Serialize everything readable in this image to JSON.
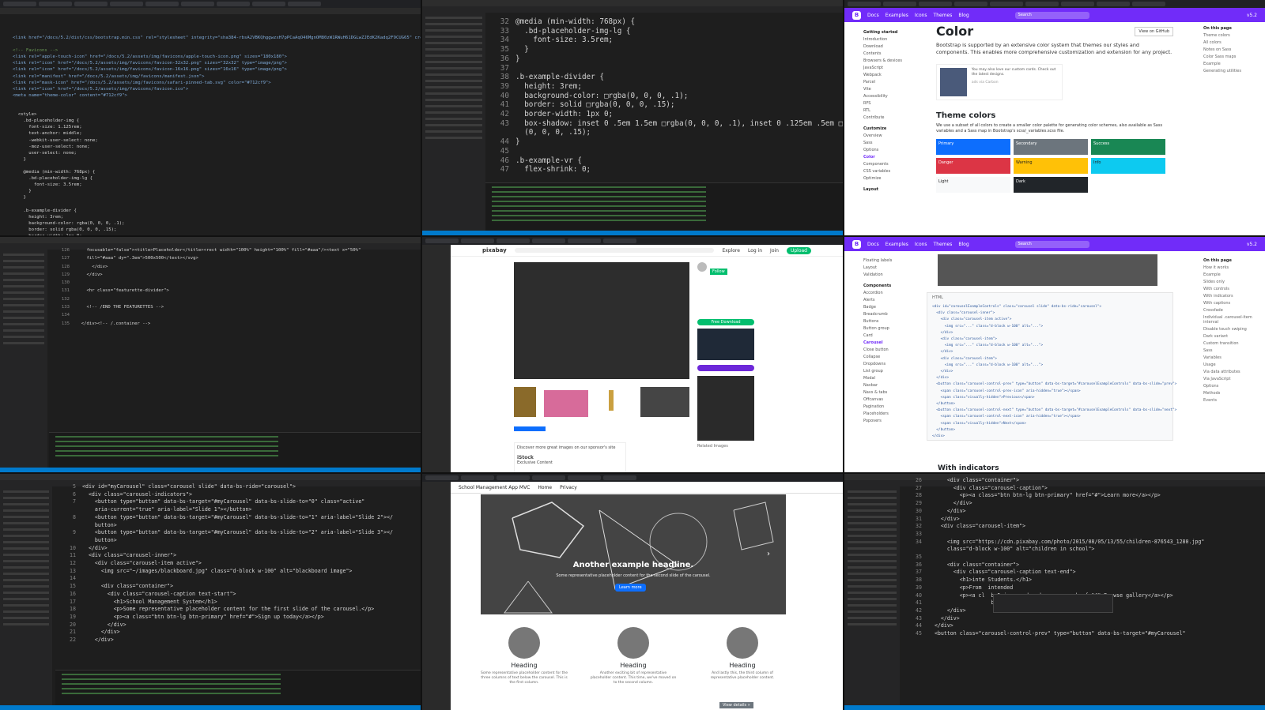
{
  "tile1": {
    "lines": [
      "<link href=\"/docs/5.2/dist/css/bootstrap.min.css\" rel=\"stylesheet\" integrity=\"sha384-rbsA2VBKQhggwzxH7pPCaAqO46MgnOM80zW1RWuH61DGLwZJEdK2Kadq2F9CUG65\" crossorigin=\"anonymous\">",
      "",
      "<!-- Favicons -->",
      "<link rel=\"apple-touch-icon\" href=\"/docs/5.2/assets/img/favicons/apple-touch-icon.png\" sizes=\"180x180\">",
      "<link rel=\"icon\" href=\"/docs/5.2/assets/img/favicons/favicon-32x32.png\" sizes=\"32x32\" type=\"image/png\">",
      "<link rel=\"icon\" href=\"/docs/5.2/assets/img/favicons/favicon-16x16.png\" sizes=\"16x16\" type=\"image/png\">",
      "<link rel=\"manifest\" href=\"/docs/5.2/assets/img/favicons/manifest.json\">",
      "<link rel=\"mask-icon\" href=\"/docs/5.2/assets/img/favicons/safari-pinned-tab.svg\" color=\"#712cf9\">",
      "<link rel=\"icon\" href=\"/docs/5.2/assets/img/favicons/favicon.ico\">",
      "<meta name=\"theme-color\" content=\"#712cf9\">",
      "",
      "",
      "  <style>",
      "    .bd-placeholder-img {",
      "      font-size: 1.125rem;",
      "      text-anchor: middle;",
      "      -webkit-user-select: none;",
      "      -moz-user-select: none;",
      "      user-select: none;",
      "    }",
      "",
      "    @media (min-width: 768px) {",
      "      .bd-placeholder-img-lg {",
      "        font-size: 3.5rem;",
      "      }",
      "    }",
      "",
      "    .b-example-divider {",
      "      height: 3rem;",
      "      background-color: rgba(0, 0, 0, .1);",
      "      border: solid rgba(0, 0, 0, .15);",
      "      border-width: 1px 0;",
      "      box-shadow: inset 0 .5em 1.5em rgba(0, 0, 0, .1), inset 0 .125em .5em rgba(0, 0, 0, .15);"
    ]
  },
  "tile2": {
    "lines": [
      {
        "n": "32",
        "t": "@media (min-width: 768px) {"
      },
      {
        "n": "33",
        "t": "  .bd-placeholder-img-lg {"
      },
      {
        "n": "34",
        "t": "    font-size: 3.5rem;"
      },
      {
        "n": "35",
        "t": "  }"
      },
      {
        "n": "36",
        "t": "}"
      },
      {
        "n": "37",
        "t": ""
      },
      {
        "n": "38",
        "t": ".b-example-divider {"
      },
      {
        "n": "39",
        "t": "  height: 3rem;"
      },
      {
        "n": "40",
        "t": "  background-color: □rgba(0, 0, 0, .1);"
      },
      {
        "n": "41",
        "t": "  border: solid □rgba(0, 0, 0, .15);"
      },
      {
        "n": "42",
        "t": "  border-width: 1px 0;"
      },
      {
        "n": "43",
        "t": "  box-shadow: inset 0 .5em 1.5em □rgba(0, 0, 0, .1), inset 0 .125em .5em □rgba"
      },
      {
        "n": "",
        "t": "  (0, 0, 0, .15);"
      },
      {
        "n": "44",
        "t": "}"
      },
      {
        "n": "45",
        "t": ""
      },
      {
        "n": "46",
        "t": ".b-example-vr {"
      },
      {
        "n": "47",
        "t": "  flex-shrink: 0;"
      }
    ]
  },
  "tile3": {
    "nav": [
      "Docs",
      "Examples",
      "Icons",
      "Themes",
      "Blog"
    ],
    "search": "Search",
    "version": "v5.2",
    "side_group1": "Getting started",
    "side_items1": [
      "Introduction",
      "Download",
      "Contents",
      "Browsers & devices",
      "JavaScript",
      "Webpack",
      "Parcel",
      "Vite",
      "Accessibility",
      "RFS",
      "RTL",
      "Contribute"
    ],
    "side_group2": "Customize",
    "side_items2": [
      "Overview",
      "Sass",
      "Options",
      "Color",
      "Components",
      "CSS variables",
      "Optimize"
    ],
    "side_group3": "Layout",
    "title": "Color",
    "view_link": "View on GitHub",
    "intro": "Bootstrap is supported by an extensive color system that themes our styles and components. This enables more comprehensive customization and extension for any project.",
    "ad_text": "You may also love our custom cards. Check out the latest designs.",
    "ad_by": "ads via Carbon",
    "theme_heading": "Theme colors",
    "theme_desc": "We use a subset of all colors to create a smaller color palette for generating color schemes, also available as Sass variables and a Sass map in Bootstrap's scss/_variables.scss file.",
    "swatches": [
      {
        "label": "Primary",
        "color": "#0d6efd"
      },
      {
        "label": "Secondary",
        "color": "#6c757d"
      },
      {
        "label": "Success",
        "color": "#198754"
      },
      {
        "label": "Danger",
        "color": "#dc3545"
      },
      {
        "label": "Warning",
        "color": "#ffc107"
      },
      {
        "label": "Info",
        "color": "#0dcaf0"
      },
      {
        "label": "Light",
        "color": "#f8f9fa"
      },
      {
        "label": "Dark",
        "color": "#212529"
      }
    ],
    "toc_title": "On this page",
    "toc": [
      "Theme colors",
      "All colors",
      "Notes on Sass",
      "Color Sass maps",
      "Example",
      "Generating utilities"
    ]
  },
  "tile4": {
    "lines": [
      {
        "n": "126",
        "t": "    focusable=\"false\"><title>Placeholder</title><rect width=\"100%\" height=\"100%\" fill=\"#aaa\"/><text x=\"50%\""
      },
      {
        "n": "127",
        "t": "    fill=\"#aaa\" dy=\".3em\">500x500</text></svg>"
      },
      {
        "n": "128",
        "t": "      </div>"
      },
      {
        "n": "129",
        "t": "    </div>"
      },
      {
        "n": "130",
        "t": ""
      },
      {
        "n": "131",
        "t": "    <hr class=\"featurette-divider\">"
      },
      {
        "n": "132",
        "t": ""
      },
      {
        "n": "133",
        "t": "    <!-- /END THE FEATURETTES -->"
      },
      {
        "n": "134",
        "t": ""
      },
      {
        "n": "135",
        "t": "  </div><!-- /.container -->"
      }
    ]
  },
  "tile5": {
    "logo": "pixabay",
    "nav": [
      "Explore",
      "Log in",
      "Join"
    ],
    "upload": "Upload",
    "follow": "Follow",
    "download": "Free Download",
    "related": "Related Images",
    "ad_title": "Discover more great images on our sponsor's site",
    "ad_brand": "iStock",
    "ad_sub": "Exclusive Content"
  },
  "tile6": {
    "nav": [
      "Docs",
      "Examples",
      "Icons",
      "Themes",
      "Blog"
    ],
    "search": "Search",
    "version": "v5.2",
    "side_top": [
      "Floating labels",
      "Layout",
      "Validation"
    ],
    "side_group": "Components",
    "side_items": [
      "Accordion",
      "Alerts",
      "Badge",
      "Breadcrumb",
      "Buttons",
      "Button group",
      "Card",
      "Carousel",
      "Close button",
      "Collapse",
      "Dropdowns",
      "List group",
      "Modal",
      "Navbar",
      "Navs & tabs",
      "Offcanvas",
      "Pagination",
      "Placeholders",
      "Popovers"
    ],
    "code_label": "HTML",
    "code": [
      "<div id=\"carouselExampleControls\" class=\"carousel slide\" data-bs-ride=\"carousel\">",
      "  <div class=\"carousel-inner\">",
      "    <div class=\"carousel-item active\">",
      "      <img src=\"...\" class=\"d-block w-100\" alt=\"...\">",
      "    </div>",
      "    <div class=\"carousel-item\">",
      "      <img src=\"...\" class=\"d-block w-100\" alt=\"...\">",
      "    </div>",
      "    <div class=\"carousel-item\">",
      "      <img src=\"...\" class=\"d-block w-100\" alt=\"...\">",
      "    </div>",
      "  </div>",
      "  <button class=\"carousel-control-prev\" type=\"button\" data-bs-target=\"#carouselExampleControls\" data-bs-slide=\"prev\">",
      "    <span class=\"carousel-control-prev-icon\" aria-hidden=\"true\"></span>",
      "    <span class=\"visually-hidden\">Previous</span>",
      "  </button>",
      "  <button class=\"carousel-control-next\" type=\"button\" data-bs-target=\"#carouselExampleControls\" data-bs-slide=\"next\">",
      "    <span class=\"carousel-control-next-icon\" aria-hidden=\"true\"></span>",
      "    <span class=\"visually-hidden\">Next</span>",
      "  </button>",
      "</div>"
    ],
    "next_heading": "With indicators",
    "toc_title": "On this page",
    "toc": [
      "How it works",
      "Example",
      "Slides only",
      "With controls",
      "With indicators",
      "With captions",
      "Crossfade",
      "Individual .carousel-item interval",
      "Disable touch swiping",
      "Dark variant",
      "Custom transition",
      "Sass",
      "Variables",
      "Usage",
      "Via data attributes",
      "Via JavaScript",
      "Options",
      "Methods",
      "Events"
    ]
  },
  "tile7": {
    "lines": [
      {
        "n": "5",
        "t": "<div id=\"myCarousel\" class=\"carousel slide\" data-bs-ride=\"carousel\">"
      },
      {
        "n": "6",
        "t": "  <div class=\"carousel-indicators\">"
      },
      {
        "n": "7",
        "t": "    <button type=\"button\" data-bs-target=\"#myCarousel\" data-bs-slide-to=\"0\" class=\"active\""
      },
      {
        "n": "",
        "t": "    aria-current=\"true\" aria-label=\"Slide 1\"></button>"
      },
      {
        "n": "8",
        "t": "    <button type=\"button\" data-bs-target=\"#myCarousel\" data-bs-slide-to=\"1\" aria-label=\"Slide 2\"></"
      },
      {
        "n": "",
        "t": "    button>"
      },
      {
        "n": "9",
        "t": "    <button type=\"button\" data-bs-target=\"#myCarousel\" data-bs-slide-to=\"2\" aria-label=\"Slide 3\"></"
      },
      {
        "n": "",
        "t": "    button>"
      },
      {
        "n": "10",
        "t": "  </div>"
      },
      {
        "n": "11",
        "t": "  <div class=\"carousel-inner\">"
      },
      {
        "n": "12",
        "t": "    <div class=\"carousel-item active\">"
      },
      {
        "n": "13",
        "t": "      <img src=\"~/images/blackboard.jpg\" class=\"d-block w-100\" alt=\"blackboard image\">"
      },
      {
        "n": "14",
        "t": ""
      },
      {
        "n": "15",
        "t": "      <div class=\"container\">"
      },
      {
        "n": "16",
        "t": "        <div class=\"carousel-caption text-start\">"
      },
      {
        "n": "17",
        "t": "          <h1>School Management System</h1>"
      },
      {
        "n": "18",
        "t": "          <p>Some representative placeholder content for the first slide of the carousel.</p>"
      },
      {
        "n": "19",
        "t": "          <p><a class=\"btn btn-lg btn-primary\" href=\"#\">Sign up today</a></p>"
      },
      {
        "n": "20",
        "t": "        </div>"
      },
      {
        "n": "21",
        "t": "      </div>"
      },
      {
        "n": "22",
        "t": "    </div>"
      }
    ]
  },
  "tile8": {
    "brand": "School Management App MVC",
    "nav": [
      "Home",
      "Privacy"
    ],
    "hero_title": "Another example headline.",
    "hero_text": "Some representative placeholder content for the second slide of the carousel.",
    "hero_button": "Learn more",
    "cols": [
      {
        "heading": "Heading",
        "text": "Some representative placeholder content for the three columns of text below the carousel. This is the first column."
      },
      {
        "heading": "Heading",
        "text": "Another exciting bit of representative placeholder content. This time, we've moved on to the second column."
      },
      {
        "heading": "Heading",
        "text": "And lastly this, the third column of representative placeholder content."
      }
    ],
    "details": "View details »"
  },
  "tile9": {
    "lines": [
      {
        "n": "26",
        "t": "      <div class=\"container\">"
      },
      {
        "n": "27",
        "t": "        <div class=\"carousel-caption\">"
      },
      {
        "n": "28",
        "t": "          <p><a class=\"btn btn-lg btn-primary\" href=\"#\">Learn more</a></p>"
      },
      {
        "n": "29",
        "t": "        </div>"
      },
      {
        "n": "30",
        "t": "      </div>"
      },
      {
        "n": "31",
        "t": "    </div>"
      },
      {
        "n": "32",
        "t": "    <div class=\"carousel-item\">"
      },
      {
        "n": "33",
        "t": ""
      },
      {
        "n": "34",
        "t": "      <img src=\"https://cdn.pixabay.com/photo/2015/08/05/13/55/children-876543_1280.jpg\""
      },
      {
        "n": "",
        "t": "      class=\"d-block w-100\" alt=\"children in school\">"
      },
      {
        "n": "35",
        "t": ""
      },
      {
        "n": "36",
        "t": "      <div class=\"container\">"
      },
      {
        "n": "37",
        "t": "        <div class=\"carousel-caption text-end\">"
      },
      {
        "n": "38",
        "t": "          <h1>inte Students.</h1>"
      },
      {
        "n": "39",
        "t": "          <p>From  intended"
      },
      {
        "n": "40",
        "t": "          <p><a cl  bs5-igroup-dropdown-seg..  href=\"#\">Browse gallery</a></p>"
      },
      {
        "n": "41",
        "t": "                    bs5-igroup-dropdown-seg..."
      },
      {
        "n": "42",
        "t": "      </div>"
      },
      {
        "n": "43",
        "t": "    </div>"
      },
      {
        "n": "44",
        "t": "  </div>"
      },
      {
        "n": "45",
        "t": "  <button class=\"carousel-control-prev\" type=\"button\" data-bs-target=\"#myCarousel\""
      }
    ]
  }
}
